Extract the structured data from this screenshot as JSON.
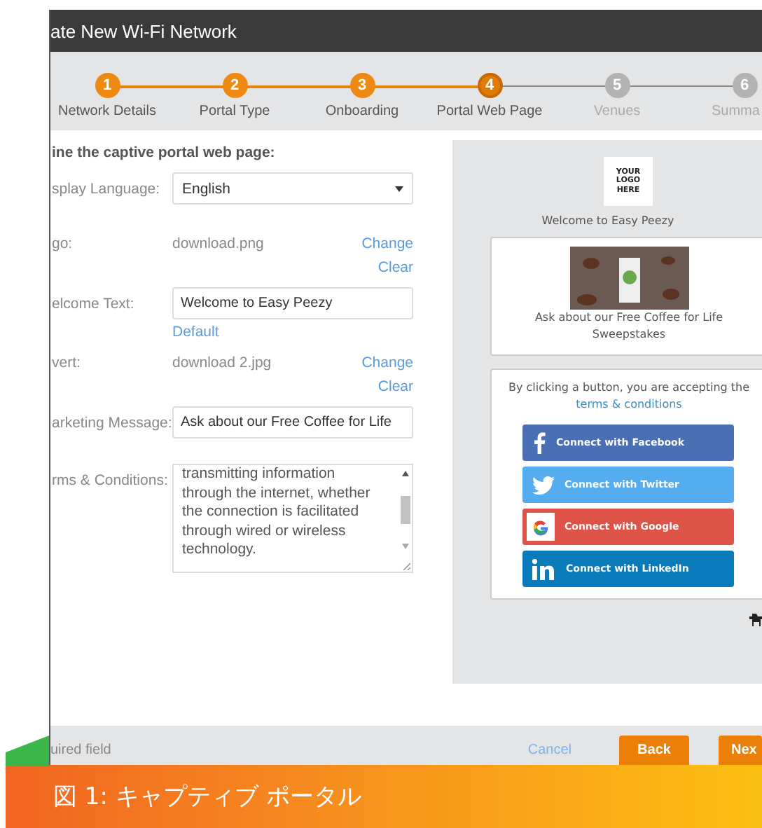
{
  "window": {
    "title": "ate New Wi-Fi Network"
  },
  "steps": [
    {
      "number": "1",
      "label": "Network Details",
      "completed": true,
      "selected": false
    },
    {
      "number": "2",
      "label": "Portal Type",
      "completed": true,
      "selected": false
    },
    {
      "number": "3",
      "label": "Onboarding",
      "completed": true,
      "selected": false
    },
    {
      "number": "4",
      "label": "Portal Web Page",
      "completed": true,
      "selected": true
    },
    {
      "number": "5",
      "label": "Venues",
      "completed": false,
      "selected": false
    },
    {
      "number": "6",
      "label": "Summa",
      "completed": false,
      "selected": false
    }
  ],
  "form": {
    "heading": "ine the captive portal web page:",
    "fields": [
      {
        "kind": "select",
        "label": "splay Language:",
        "value": "English"
      },
      {
        "kind": "file",
        "label": "go:",
        "value": "download.png",
        "actions": [
          "Change",
          "Clear"
        ]
      },
      {
        "kind": "text",
        "label": "elcome Text:",
        "value": "Welcome to Easy Peezy",
        "link": "Default"
      },
      {
        "kind": "file",
        "label": "vert:",
        "value": "download 2.jpg",
        "actions": [
          "Change",
          "Clear"
        ]
      },
      {
        "kind": "text",
        "label": "arketing Message:",
        "value": "Ask about our Free Coffee for Life"
      },
      {
        "kind": "textarea",
        "label": "rms & Conditions:",
        "lines": [
          "transmitting information",
          "through the internet, whether",
          "the connection is facilitated",
          "through wired or wireless",
          "technology."
        ]
      }
    ]
  },
  "preview": {
    "logo_text": "YOUR LOGO HERE",
    "welcome": "Welcome to Easy Peezy",
    "advert_caption": "Ask about our Free Coffee for Life Sweepstakes",
    "consent_text": "By clicking a button, you are accepting the",
    "terms_link": "terms & conditions",
    "social_buttons": [
      {
        "kind": "facebook",
        "label": "Connect with Facebook"
      },
      {
        "kind": "twitter",
        "label": "Connect with Twitter"
      },
      {
        "kind": "google",
        "label": "Connect with Google"
      },
      {
        "kind": "linkedin",
        "label": "Connect with LinkedIn"
      }
    ]
  },
  "footer": {
    "required_note": "uired field",
    "cancel": "Cancel",
    "buttons": [
      "Back",
      "Nex"
    ]
  },
  "caption": "図 1: キャプティブ ポータル"
}
